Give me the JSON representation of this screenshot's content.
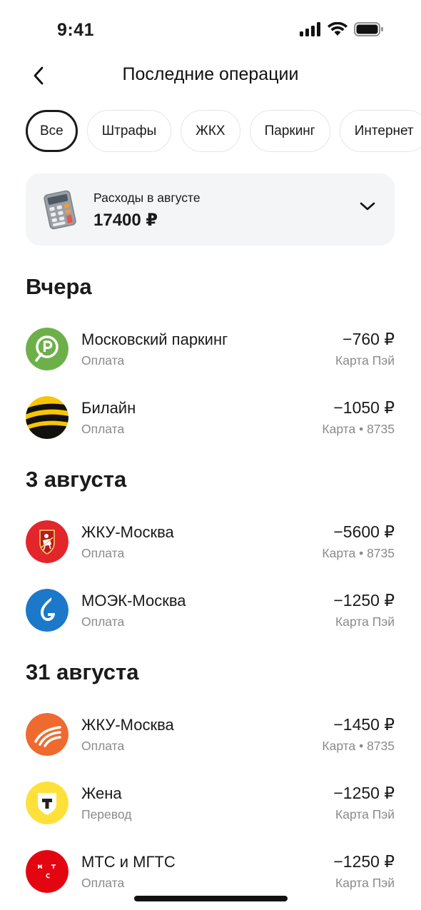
{
  "status_bar": {
    "time": "9:41"
  },
  "header": {
    "title": "Последние операции"
  },
  "filters": [
    {
      "label": "Все",
      "active": true
    },
    {
      "label": "Штрафы",
      "active": false
    },
    {
      "label": "ЖКХ",
      "active": false
    },
    {
      "label": "Паркинг",
      "active": false
    },
    {
      "label": "Интернет",
      "active": false
    }
  ],
  "summary": {
    "label": "Расходы в августе",
    "amount": "17400 ₽",
    "icon": "calculator-icon"
  },
  "sections": [
    {
      "title": "Вчера",
      "items": [
        {
          "name": "Московский паркинг",
          "type": "Оплата",
          "amount": "−760 ₽",
          "method": "Карта Пэй",
          "icon": "parking-icon",
          "color": "#6db04a"
        },
        {
          "name": "Билайн",
          "type": "Оплата",
          "amount": "−1050 ₽",
          "method": "Карта • 8735",
          "icon": "beeline-icon",
          "color": "#f7c600"
        }
      ]
    },
    {
      "title": "3 августа",
      "items": [
        {
          "name": "ЖКУ-Москва",
          "type": "Оплата",
          "amount": "−5600 ₽",
          "method": "Карта • 8735",
          "icon": "moscow-emblem-icon",
          "color": "#e3262b"
        },
        {
          "name": "МОЭК-Москва",
          "type": "Оплата",
          "amount": "−1250 ₽",
          "method": "Карта Пэй",
          "icon": "gas-flame-icon",
          "color": "#1c78c9"
        }
      ]
    },
    {
      "title": "31 августа",
      "items": [
        {
          "name": "ЖКУ-Москва",
          "type": "Оплата",
          "amount": "−1450 ₽",
          "method": "Карта • 8735",
          "icon": "stripes-logo-icon",
          "color": "#ef6a2f"
        },
        {
          "name": "Жена",
          "type": "Перевод",
          "amount": "−1250 ₽",
          "method": "Карта Пэй",
          "icon": "tbank-shield-icon",
          "color": "#fde13a"
        },
        {
          "name": "МТС и МГТС",
          "type": "Оплата",
          "amount": "−1250 ₽",
          "method": "Карта Пэй",
          "icon": "mts-icon",
          "color": "#e30611"
        }
      ]
    }
  ]
}
